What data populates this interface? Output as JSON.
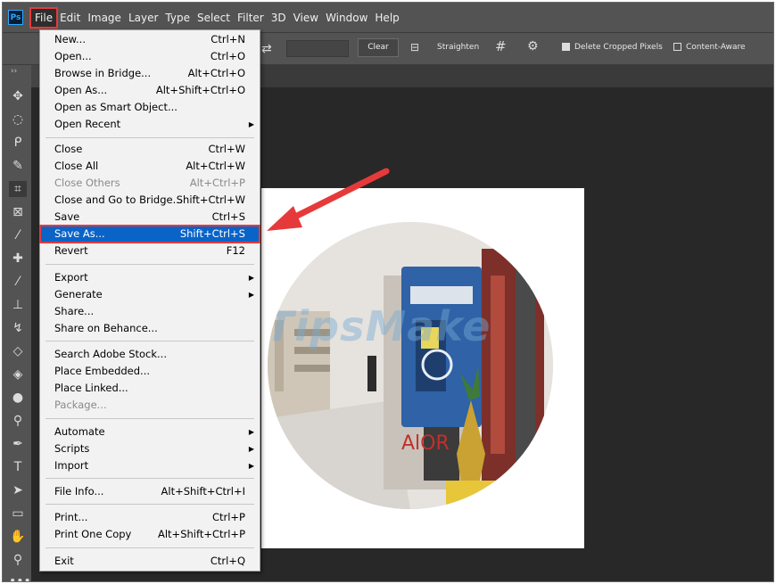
{
  "menubar": {
    "logo": "Ps",
    "items": [
      "File",
      "Edit",
      "Image",
      "Layer",
      "Type",
      "Select",
      "Filter",
      "3D",
      "View",
      "Window",
      "Help"
    ]
  },
  "options": {
    "clear_label": "Clear",
    "straighten_label": "Straighten",
    "delete_cropped_label": "Delete Cropped Pixels",
    "delete_cropped_checked": true,
    "content_aware_label": "Content-Aware",
    "content_aware_checked": false
  },
  "file_menu": {
    "items": [
      {
        "label": "New...",
        "shortcut": "Ctrl+N"
      },
      {
        "label": "Open...",
        "shortcut": "Ctrl+O"
      },
      {
        "label": "Browse in Bridge...",
        "shortcut": "Alt+Ctrl+O"
      },
      {
        "label": "Open As...",
        "shortcut": "Alt+Shift+Ctrl+O"
      },
      {
        "label": "Open as Smart Object..."
      },
      {
        "label": "Open Recent",
        "submenu": true
      },
      {
        "label": "Close",
        "shortcut": "Ctrl+W"
      },
      {
        "label": "Close All",
        "shortcut": "Alt+Ctrl+W"
      },
      {
        "label": "Close Others",
        "shortcut": "Alt+Ctrl+P",
        "disabled": true
      },
      {
        "label": "Close and Go to Bridge...",
        "shortcut": "Shift+Ctrl+W"
      },
      {
        "label": "Save",
        "shortcut": "Ctrl+S"
      },
      {
        "label": "Save As...",
        "shortcut": "Shift+Ctrl+S",
        "highlighted": true
      },
      {
        "label": "Revert",
        "shortcut": "F12"
      },
      {
        "label": "Export",
        "submenu": true
      },
      {
        "label": "Generate",
        "submenu": true
      },
      {
        "label": "Share..."
      },
      {
        "label": "Share on Behance..."
      },
      {
        "label": "Search Adobe Stock..."
      },
      {
        "label": "Place Embedded..."
      },
      {
        "label": "Place Linked..."
      },
      {
        "label": "Package...",
        "disabled": true
      },
      {
        "label": "Automate",
        "submenu": true
      },
      {
        "label": "Scripts",
        "submenu": true
      },
      {
        "label": "Import",
        "submenu": true
      },
      {
        "label": "File Info...",
        "shortcut": "Alt+Shift+Ctrl+I"
      },
      {
        "label": "Print...",
        "shortcut": "Ctrl+P"
      },
      {
        "label": "Print One Copy",
        "shortcut": "Alt+Shift+Ctrl+P"
      },
      {
        "label": "Exit",
        "shortcut": "Ctrl+Q"
      }
    ]
  },
  "canvas": {
    "watermark": "TipsMake"
  },
  "colors": {
    "menubar": "#535353",
    "workspace": "#282828",
    "highlight": "#0a64c8",
    "annotation": "#e63a3a"
  }
}
